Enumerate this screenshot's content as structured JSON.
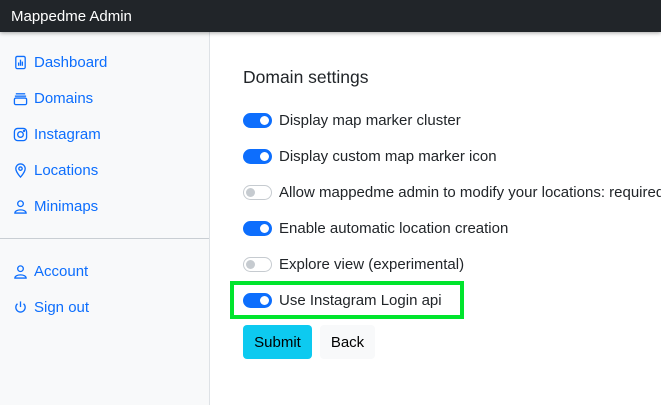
{
  "app": {
    "title": "Mappedme Admin"
  },
  "sidebar": {
    "items": [
      {
        "label": "Dashboard",
        "icon": "dashboard-icon"
      },
      {
        "label": "Domains",
        "icon": "domains-icon"
      },
      {
        "label": "Instagram",
        "icon": "instagram-icon"
      },
      {
        "label": "Locations",
        "icon": "location-pin-icon"
      },
      {
        "label": "Minimaps",
        "icon": "person-icon"
      }
    ],
    "account_items": [
      {
        "label": "Account",
        "icon": "user-icon"
      },
      {
        "label": "Sign out",
        "icon": "power-icon"
      }
    ]
  },
  "main": {
    "heading": "Domain settings",
    "settings": [
      {
        "label": "Display map marker cluster",
        "enabled": true
      },
      {
        "label": "Display custom map marker icon",
        "enabled": true
      },
      {
        "label": "Allow mappedme admin to modify your locations: required",
        "enabled": false
      },
      {
        "label": "Enable automatic location creation",
        "enabled": true
      },
      {
        "label": "Explore view (experimental)",
        "enabled": false
      },
      {
        "label": "Use Instagram Login api",
        "enabled": true
      }
    ],
    "buttons": {
      "submit": "Submit",
      "back": "Back"
    }
  },
  "colors": {
    "topbar": "#212529",
    "link": "#0d6efd",
    "switch_on": "#0d6efd",
    "submit": "#0dcaf0",
    "highlight": "#00e52d"
  }
}
